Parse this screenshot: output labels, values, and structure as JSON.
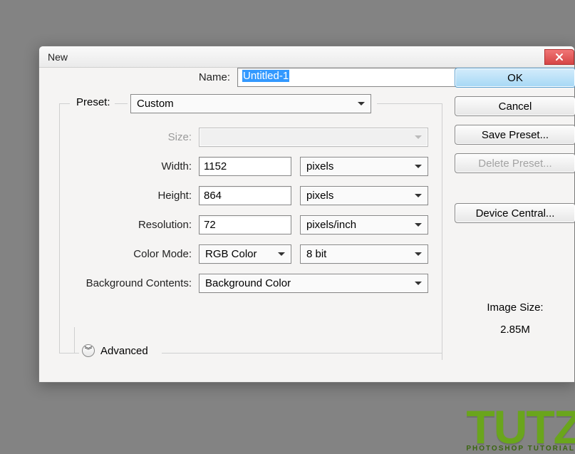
{
  "dialog": {
    "title": "New",
    "name_label": "Name:",
    "name_value": "Untitled-1",
    "preset_label": "Preset:",
    "preset_value": "Custom",
    "size_label": "Size:",
    "size_value": "",
    "width_label": "Width:",
    "width_value": "1152",
    "width_unit": "pixels",
    "height_label": "Height:",
    "height_value": "864",
    "height_unit": "pixels",
    "res_label": "Resolution:",
    "res_value": "72",
    "res_unit": "pixels/inch",
    "color_mode_label": "Color Mode:",
    "color_mode_value": "RGB Color",
    "color_depth_value": "8 bit",
    "bg_label": "Background Contents:",
    "bg_value": "Background Color",
    "advanced_label": "Advanced"
  },
  "buttons": {
    "ok": "OK",
    "cancel": "Cancel",
    "save_preset": "Save Preset...",
    "delete_preset": "Delete Preset...",
    "device_central": "Device Central..."
  },
  "image_size": {
    "label": "Image Size:",
    "value": "2.85M"
  },
  "watermark": {
    "big": "TUTZ",
    "small": "PHOTOSHOP TUTORIAL"
  }
}
